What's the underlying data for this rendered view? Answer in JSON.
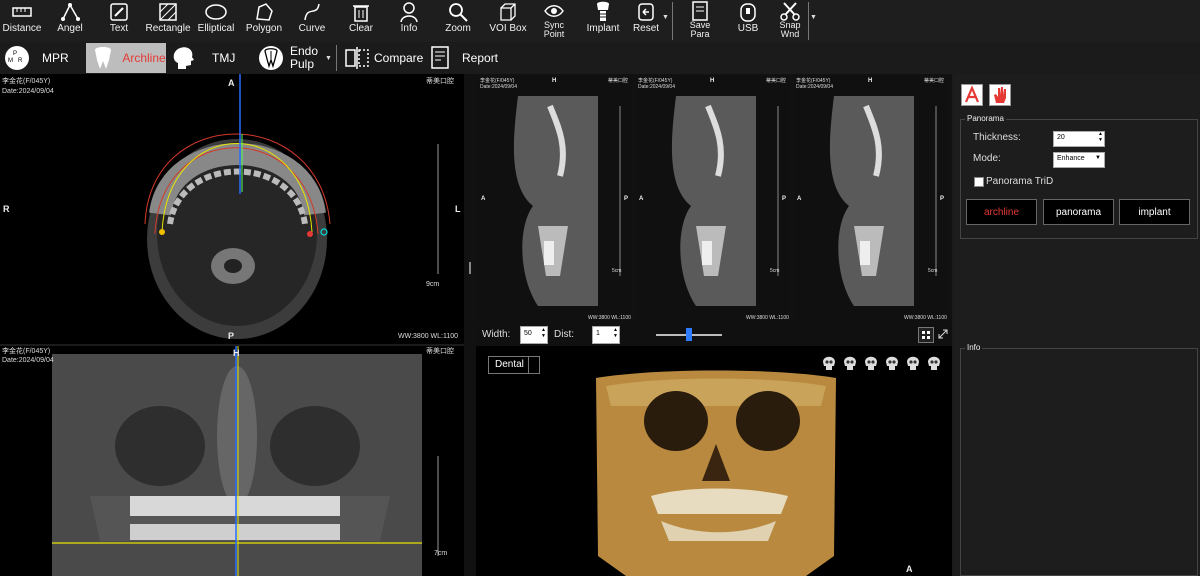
{
  "toolbar": {
    "tools": [
      {
        "id": "distance",
        "label": "Distance",
        "icon": "ruler-icon"
      },
      {
        "id": "angle",
        "label": "Angel",
        "icon": "angle-icon"
      },
      {
        "id": "text",
        "label": "Text",
        "icon": "text-pencil-icon"
      },
      {
        "id": "rectangle",
        "label": "Rectangle",
        "icon": "rectangle-icon"
      },
      {
        "id": "elliptical",
        "label": "Elliptical",
        "icon": "ellipse-icon"
      },
      {
        "id": "polygon",
        "label": "Polygon",
        "icon": "polygon-icon"
      },
      {
        "id": "curve",
        "label": "Curve",
        "icon": "curve-icon"
      },
      {
        "id": "clear",
        "label": "Clear",
        "icon": "trash-icon"
      },
      {
        "id": "info",
        "label": "Info",
        "icon": "user-info-icon"
      },
      {
        "id": "zoom",
        "label": "Zoom",
        "icon": "magnifier-icon"
      },
      {
        "id": "voibox",
        "label": "VOI Box",
        "icon": "cube-icon"
      },
      {
        "id": "syncpoint",
        "label": "Sync\nPoint",
        "icon": "eye-sync-icon"
      },
      {
        "id": "implant",
        "label": "Implant",
        "icon": "implant-icon"
      },
      {
        "id": "reset",
        "label": "Reset",
        "icon": "reset-icon"
      },
      {
        "id": "savepara",
        "label": "Save\nPara",
        "icon": "document-icon"
      },
      {
        "id": "usb",
        "label": "USB",
        "icon": "usb-lock-icon"
      },
      {
        "id": "snapwnd",
        "label": "Snap\nWnd",
        "icon": "scissors-icon"
      }
    ]
  },
  "modes": {
    "mpr": "MPR",
    "archline": "Archline",
    "tmj": "TMJ",
    "endo_pulp": "Endo Pulp",
    "compare": "Compare",
    "report": "Report"
  },
  "axial": {
    "patient": "李金花(F/045Y)",
    "date": "Date:2024/09/04",
    "clinic": "蒂美口腔",
    "orient_top": "A",
    "orient_left": "R",
    "orient_right": "L",
    "orient_bottom": "P",
    "scale": "9cm",
    "window": "WW:3800 WL:1100"
  },
  "pano": {
    "patient": "李金花(F/045Y)",
    "date": "Date:2024/09/04",
    "clinic": "蒂美口腔",
    "orient_top": "H",
    "scale": "7cm"
  },
  "slices": {
    "patient": "李金花(F/045Y)",
    "date": "Date:2024/09/04",
    "clinic": "蒂美口腔",
    "orient_top": "H",
    "orient_left": "A",
    "orient_right": "P",
    "scale": "5cm",
    "window": "WW:3800 WL:1100"
  },
  "slice_controls": {
    "width_label": "Width:",
    "width_value": "50",
    "dist_label": "Dist:",
    "dist_value": "1",
    "slider_fraction": 0.5
  },
  "render3d": {
    "preset": "Dental",
    "orient_bottom": "A"
  },
  "right_panel": {
    "panorama_group": "Panorama",
    "thickness_label": "Thickness:",
    "thickness_value": "20",
    "mode_label": "Mode:",
    "mode_value": "Enhance",
    "trid_label": "Panorama TriD",
    "trid_checked": false,
    "btn_archline": "archline",
    "btn_panorama": "panorama",
    "btn_implant": "implant",
    "info_group": "Info"
  },
  "colors": {
    "accent_red": "#e53935",
    "bone": "#c9a35a"
  }
}
